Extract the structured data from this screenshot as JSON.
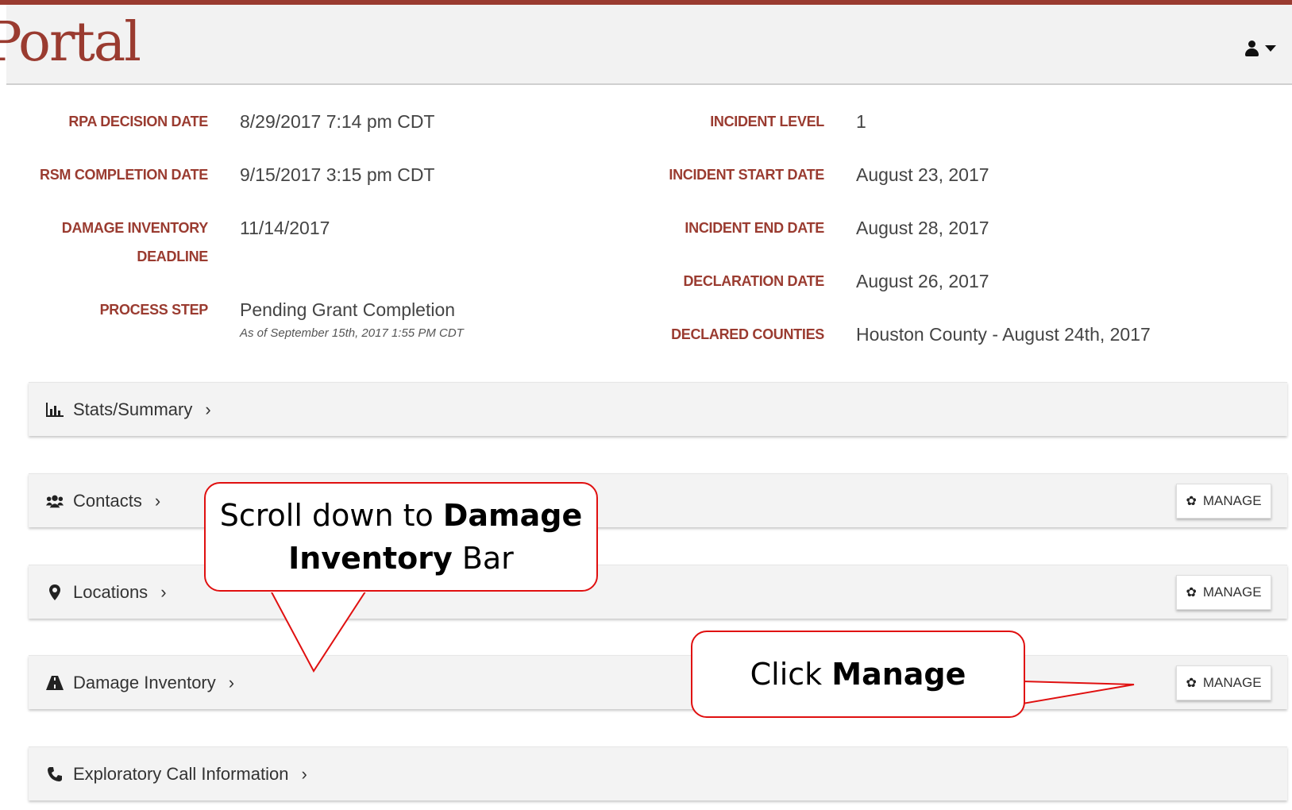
{
  "app": {
    "title_fragment": "Portal"
  },
  "header": {
    "user_icon": "user-icon",
    "menu_icon": "caret-down-icon"
  },
  "details_left": [
    {
      "label": "RPA DECISION DATE",
      "value": "8/29/2017 7:14 pm CDT"
    },
    {
      "label": "RSM COMPLETION DATE",
      "value": "9/15/2017 3:15 pm CDT"
    },
    {
      "label_line1": "DAMAGE INVENTORY",
      "label_line2": "DEADLINE",
      "value": "11/14/2017"
    },
    {
      "label": "PROCESS STEP",
      "value": "Pending Grant Completion",
      "sub": "As of September 15th, 2017 1:55 PM CDT"
    }
  ],
  "details_right": [
    {
      "label": "INCIDENT LEVEL",
      "value": "1"
    },
    {
      "label": "INCIDENT START DATE",
      "value": "August 23, 2017"
    },
    {
      "label": "INCIDENT END DATE",
      "value": "August 28, 2017"
    },
    {
      "label": "DECLARATION DATE",
      "value": "August 26, 2017"
    },
    {
      "label": "DECLARED COUNTIES",
      "value": "Houston County - August 24th, 2017"
    }
  ],
  "sections": [
    {
      "label": "Stats/Summary",
      "icon": "bar-chart-icon",
      "chevron": "›"
    },
    {
      "label": "Contacts",
      "icon": "users-icon",
      "chevron": "›",
      "button": "MANAGE"
    },
    {
      "label": "Locations",
      "icon": "map-marker-icon",
      "chevron": "›",
      "button": "MANAGE"
    },
    {
      "label": "Damage Inventory",
      "icon": "road-icon",
      "chevron": "›",
      "button": "MANAGE"
    },
    {
      "label": "Exploratory Call Information",
      "icon": "phone-icon",
      "chevron": "›"
    }
  ],
  "callouts": {
    "scroll": {
      "line1_prefix": "Scroll down to ",
      "line1_bold": "Damage",
      "line2_bold": "Inventory",
      "line2_suffix": " Bar"
    },
    "click": {
      "prefix": "Click ",
      "bold": "Manage"
    }
  },
  "colors": {
    "accent": "#9a3b30",
    "callout_border": "#e01010",
    "bar_bg": "#f3f3f3",
    "header_bg": "#f2f2f2"
  }
}
